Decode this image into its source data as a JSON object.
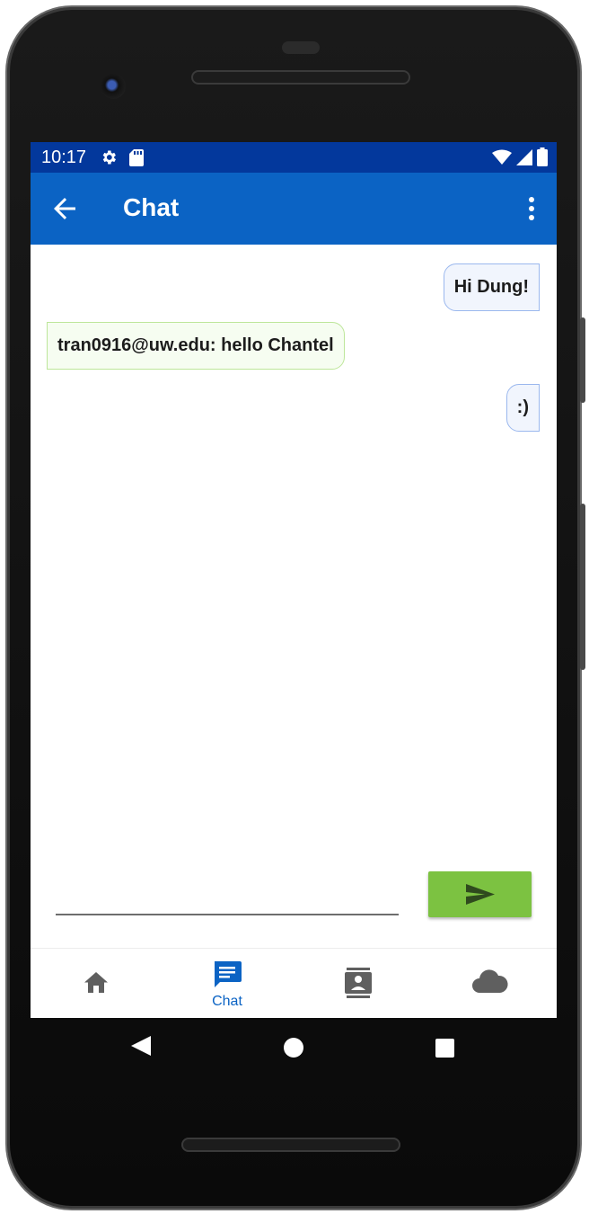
{
  "status_bar": {
    "time": "10:17",
    "left_icons": [
      "settings-icon",
      "sd-card-icon"
    ],
    "right_icons": [
      "wifi-icon",
      "cellular-signal-icon",
      "battery-icon"
    ],
    "background": "#03389c"
  },
  "app_bar": {
    "title": "Chat",
    "background": "#0b63c4"
  },
  "messages": [
    {
      "direction": "sent",
      "text": "Hi Dung!"
    },
    {
      "direction": "received",
      "text": "tran0916@uw.edu: hello Chantel"
    },
    {
      "direction": "sent",
      "text": ":)"
    }
  ],
  "compose": {
    "input_value": "",
    "send_button_color": "#7cc241"
  },
  "bottom_nav": {
    "items": [
      {
        "icon": "home-icon",
        "label": "",
        "active": false
      },
      {
        "icon": "chat-icon",
        "label": "Chat",
        "active": true
      },
      {
        "icon": "contacts-icon",
        "label": "",
        "active": false
      },
      {
        "icon": "cloud-icon",
        "label": "",
        "active": false
      }
    ],
    "active_color": "#0b63c4",
    "inactive_color": "#5f5f5f"
  },
  "system_nav": {
    "buttons": [
      "back-triangle-icon",
      "home-circle-icon",
      "recents-square-icon"
    ]
  }
}
